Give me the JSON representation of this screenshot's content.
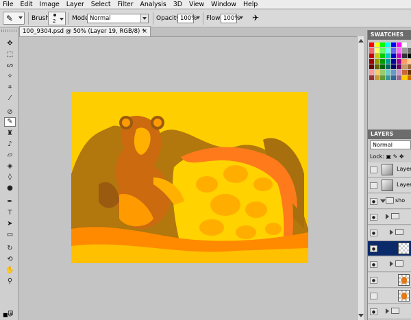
{
  "menubar": {
    "items": [
      "File",
      "Edit",
      "Image",
      "Layer",
      "Select",
      "Filter",
      "Analysis",
      "3D",
      "View",
      "Window",
      "Help"
    ]
  },
  "options_bar": {
    "brush_label": "Brush:",
    "brush_size": "2",
    "mode_label": "Mode:",
    "mode_value": "Normal",
    "opacity_label": "Opacity:",
    "opacity_value": "100%",
    "flow_label": "Flow:",
    "flow_value": "100%"
  },
  "document": {
    "tab_title": "100_9304.psd @ 50% (Layer 19, RGB/8) *",
    "close_glyph": "×"
  },
  "swatches_panel": {
    "title": "SWATCHES",
    "colors": [
      "#ff0000",
      "#ffff00",
      "#00ff00",
      "#00ffff",
      "#0000ff",
      "#ff00ff",
      "#ffffff",
      "#cccccc",
      "#ff6666",
      "#ffff66",
      "#66ff66",
      "#66ffff",
      "#6666ff",
      "#ff66ff",
      "#999999",
      "#666666",
      "#cc0000",
      "#cccc00",
      "#00cc00",
      "#00cccc",
      "#0000cc",
      "#cc00cc",
      "#333333",
      "#000000",
      "#990000",
      "#999900",
      "#009900",
      "#009999",
      "#000099",
      "#990099",
      "#ff9966",
      "#ffcc99",
      "#660000",
      "#666600",
      "#006600",
      "#006666",
      "#000066",
      "#660066",
      "#cc9966",
      "#996633",
      "#ff9999",
      "#ffcc66",
      "#99cc66",
      "#66cccc",
      "#6699cc",
      "#cc99cc",
      "#cc6633",
      "#663300",
      "#993333",
      "#cc9933",
      "#669933",
      "#339999",
      "#336699",
      "#996699",
      "#ffcc00",
      "#cc6600"
    ]
  },
  "layers_panel": {
    "title": "LAYERS",
    "blend_mode": "Normal",
    "lock_label": "Lock:",
    "rows": [
      {
        "name": "Layer",
        "visible": false,
        "kind": "gray"
      },
      {
        "name": "Layer",
        "visible": false,
        "kind": "gray"
      },
      {
        "name": "sho",
        "visible": true,
        "kind": "group"
      },
      {
        "name": "",
        "visible": true,
        "kind": "group"
      },
      {
        "name": "",
        "visible": true,
        "kind": "group"
      },
      {
        "name": "",
        "visible": true,
        "kind": "selected"
      },
      {
        "name": "",
        "visible": true,
        "kind": "group"
      },
      {
        "name": "",
        "visible": true,
        "kind": "orange"
      },
      {
        "name": "",
        "visible": false,
        "kind": "orange"
      },
      {
        "name": "",
        "visible": true,
        "kind": "group"
      },
      {
        "name": "",
        "visible": true,
        "kind": "group"
      }
    ]
  },
  "colors": {
    "foreground": "#ff7a00",
    "background": "#ffb000",
    "canvas_base": "#ffce00"
  }
}
